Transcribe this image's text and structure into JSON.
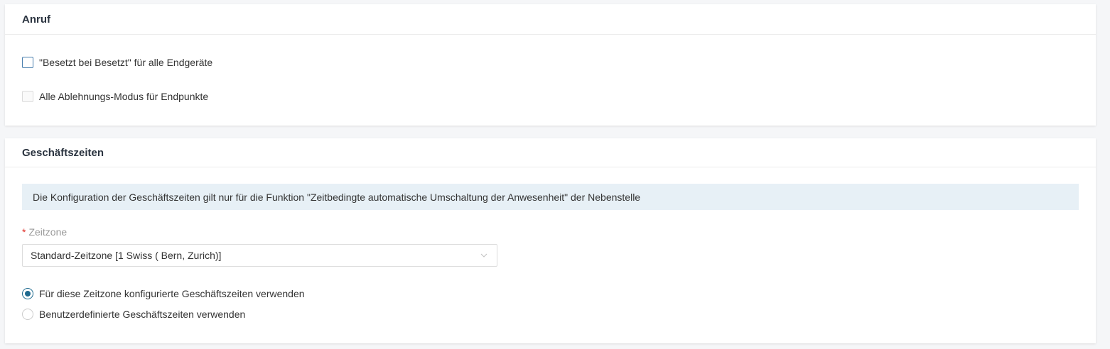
{
  "anruf": {
    "title": "Anruf",
    "checkbox_busy": "\"Besetzt bei Besetzt\" für alle Endgeräte",
    "checkbox_reject": "Alle Ablehnungs-Modus für Endpunkte"
  },
  "geschaeftszeiten": {
    "title": "Geschäftszeiten",
    "info": "Die Konfiguration der Geschäftszeiten gilt nur für die Funktion \"Zeitbedingte automatische Umschaltung der Anwesenheit\" der Nebenstelle",
    "timezone_required_mark": "*",
    "timezone_label": "Zeitzone",
    "timezone_value": "Standard-Zeitzone [1 Swiss ( Bern, Zurich)]",
    "radio_configured": "Für diese Zeitzone konfigurierte Geschäftszeiten verwenden",
    "radio_custom": "Benutzerdefinierte Geschäftszeiten verwenden",
    "selected_radio": "configured"
  },
  "colors": {
    "accent": "#1e6a8f",
    "info_bg": "#e7f0f6",
    "required": "#e0312a"
  }
}
